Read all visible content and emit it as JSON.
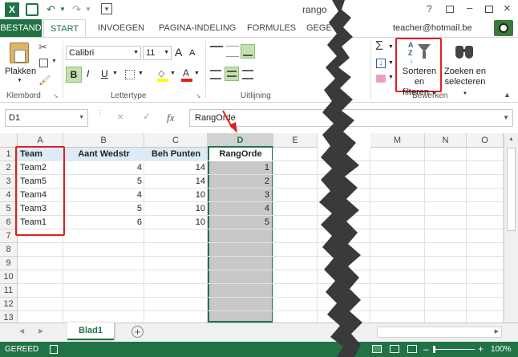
{
  "window": {
    "title": "rango",
    "user": "teacher@hotmail.be",
    "controls": [
      "?",
      "□",
      "–",
      "□",
      "×"
    ]
  },
  "tabs": [
    "BESTAND",
    "START",
    "INVOEGEN",
    "PAGINA-INDELING",
    "FORMULES",
    "GEGEV"
  ],
  "ribbon": {
    "paste_label": "Plakken",
    "clipboard_group": "Klembord",
    "font_name": "Calibri",
    "font_size": "11",
    "font_group": "Lettertype",
    "bold": "B",
    "italic": "I",
    "underline": "U",
    "align_group": "Uitlijning",
    "edit_group": "Bewerken",
    "sort_label_1": "Sorteren en",
    "sort_label_2": "filteren",
    "find_label_1": "Zoeken en",
    "find_label_2": "selecteren",
    "grow_font": "A",
    "shrink_font": "A"
  },
  "formula_bar": {
    "name_box": "D1",
    "fx": "fx",
    "content": "RangOrde"
  },
  "sheet": {
    "columns_left": [
      "A",
      "B",
      "C",
      "D",
      "E"
    ],
    "columns_right": [
      "M",
      "N",
      "O"
    ],
    "rows": [
      "1",
      "2",
      "3",
      "4",
      "5",
      "6",
      "7",
      "8",
      "9",
      "10",
      "11",
      "12",
      "13"
    ],
    "header_row": [
      "Team",
      "Aant Wedstr",
      "Beh Punten",
      "RangOrde"
    ],
    "data": [
      [
        "Team2",
        "4",
        "14",
        "1"
      ],
      [
        "Team5",
        "5",
        "14",
        "2"
      ],
      [
        "Team4",
        "4",
        "10",
        "3"
      ],
      [
        "Team3",
        "5",
        "10",
        "4"
      ],
      [
        "Team1",
        "6",
        "10",
        "5"
      ]
    ]
  },
  "sheet_tab": "Blad1",
  "status": {
    "left": "GEREED",
    "zoom": "100%",
    "minus": "–",
    "plus": "+"
  },
  "colors": {
    "accent": "#217346",
    "highlight": "#e02020",
    "selected_col": "#c8c8c8"
  }
}
